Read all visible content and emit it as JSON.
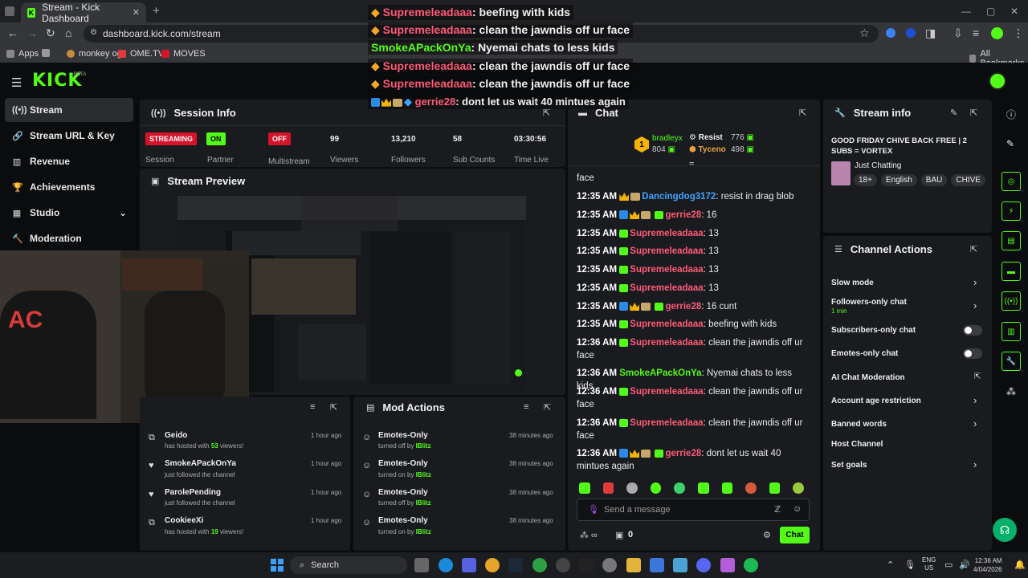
{
  "browser": {
    "tab_title": "Stream - Kick Dashboard",
    "url": "dashboard.kick.com/stream",
    "bookmarks": [
      "Apps",
      "monkey og",
      "OME.TV",
      "MOVES"
    ],
    "all_bookmarks": "All Bookmarks"
  },
  "brand": {
    "logo": "KICK",
    "beta": "BETA",
    "accent": "#53fc18"
  },
  "sidebar": {
    "items": [
      {
        "label": "Stream",
        "icon": "broadcast-icon"
      },
      {
        "label": "Stream URL & Key",
        "icon": "link-icon"
      },
      {
        "label": "Revenue",
        "icon": "chart-icon"
      },
      {
        "label": "Achievements",
        "icon": "trophy-icon"
      },
      {
        "label": "Studio",
        "icon": "grid-icon"
      },
      {
        "label": "Moderation",
        "icon": "gavel-icon"
      }
    ]
  },
  "session": {
    "title": "Session Info",
    "stats": [
      {
        "value": "STREAMING",
        "label": "Session"
      },
      {
        "value": "ON",
        "label": "Partner"
      },
      {
        "value": "OFF",
        "label": "Multistream"
      },
      {
        "value": "99",
        "label": "Viewers"
      },
      {
        "value": "13,210",
        "label": "Followers"
      },
      {
        "value": "58",
        "label": "Sub Counts"
      },
      {
        "value": "03:30:56",
        "label": "Time Live"
      }
    ]
  },
  "preview": {
    "title": "Stream Preview"
  },
  "hosts": [
    {
      "name": "Geido",
      "pre": "has hosted with ",
      "count": "53",
      "post": " viewers!",
      "time": "1 hour ago"
    },
    {
      "name": "SmokeAPackOnYa",
      "pre": "just followed the channel",
      "count": "",
      "post": "",
      "time": "1 hour ago"
    },
    {
      "name": "ParolePending",
      "pre": "just followed the channel",
      "count": "",
      "post": "",
      "time": "1 hour ago"
    },
    {
      "name": "CookieeXi",
      "pre": "has hosted with ",
      "count": "19",
      "post": " viewers!",
      "time": "1 hour ago"
    }
  ],
  "mod_actions": {
    "title": "Mod Actions",
    "items": [
      {
        "name": "Emotes-Only",
        "action": "turned off by ",
        "by": "IBlitz",
        "time": "38 minutes ago"
      },
      {
        "name": "Emotes-Only",
        "action": "turned on by ",
        "by": "IBlitz",
        "time": "38 minutes ago"
      },
      {
        "name": "Emotes-Only",
        "action": "turned off by ",
        "by": "IBlitz",
        "time": "38 minutes ago"
      },
      {
        "name": "Emotes-Only",
        "action": "turned on by ",
        "by": "IBlitz",
        "time": "38 minutes ago"
      }
    ]
  },
  "chat": {
    "title": "Chat",
    "top_user": {
      "rank": "1",
      "name": "bradleyx",
      "amount": "804"
    },
    "others": [
      {
        "name": "Resist",
        "amount": "776"
      },
      {
        "name": "Tyceno",
        "amount": "498"
      }
    ],
    "messages": [
      {
        "time": "",
        "user": "",
        "color": "#ffffff",
        "text": "face"
      },
      {
        "time": "12:35 AM",
        "user": "Dancingdog3172",
        "color": "#3fa3ff",
        "text": ": resist in drag blob"
      },
      {
        "time": "12:35 AM",
        "user": "gerrie28",
        "color": "#ff5a7a",
        "text": ": 16"
      },
      {
        "time": "12:35 AM",
        "user": "Supremeleadaaa",
        "color": "#ff5a7a",
        "text": ": 13"
      },
      {
        "time": "12:35 AM",
        "user": "Supremeleadaaa",
        "color": "#ff5a7a",
        "text": ": 13"
      },
      {
        "time": "12:35 AM",
        "user": "Supremeleadaaa",
        "color": "#ff5a7a",
        "text": ": 13"
      },
      {
        "time": "12:35 AM",
        "user": "Supremeleadaaa",
        "color": "#ff5a7a",
        "text": ": 13"
      },
      {
        "time": "12:35 AM",
        "user": "gerrie28",
        "color": "#ff5a7a",
        "text": ": 16 cunt"
      },
      {
        "time": "12:35 AM",
        "user": "Supremeleadaaa",
        "color": "#ff5a7a",
        "text": ": beefing with kids"
      },
      {
        "time": "12:36 AM",
        "user": "Supremeleadaaa",
        "color": "#ff5a7a",
        "text": ": clean the jawndis off ur face"
      },
      {
        "time": "12:36 AM",
        "user": "SmokeAPackOnYa",
        "color": "#53fc18",
        "text": ": Nyemai chats to less kids"
      },
      {
        "time": "12:36 AM",
        "user": "Supremeleadaaa",
        "color": "#ff5a7a",
        "text": ": clean the jawndis off ur face"
      },
      {
        "time": "12:36 AM",
        "user": "Supremeleadaaa",
        "color": "#ff5a7a",
        "text": ": clean the jawndis off ur face"
      },
      {
        "time": "12:36 AM",
        "user": "gerrie28",
        "color": "#ff5a7a",
        "text": ": dont let us wait 40 mintues again"
      }
    ],
    "placeholder": "Send a message",
    "viewers": "0",
    "send": "Chat"
  },
  "overlay": [
    {
      "user": "Supremeleadaaa",
      "text": ": beefing with kids"
    },
    {
      "user": "Supremeleadaaa",
      "text": ": clean the jawndis off ur face"
    },
    {
      "user": "SmokeAPackOnYa",
      "text": ": Nyemai chats to less kids"
    },
    {
      "user": "Supremeleadaaa",
      "text": ": clean the jawndis off ur face"
    },
    {
      "user": "Supremeleadaaa",
      "text": ": clean the jawndis off ur face"
    },
    {
      "user": "gerrie28",
      "text": ": dont let us wait 40 mintues again"
    }
  ],
  "stream_info": {
    "title": "Stream info",
    "stream_title": "GOOD FRIDAY CHIVE BACK FREE | 2 SUBS = VORTEX",
    "category": "Just Chatting",
    "tags": [
      "18+",
      "English",
      "BAU",
      "CHIVE"
    ]
  },
  "channel_actions": {
    "title": "Channel Actions",
    "items": [
      {
        "label": "Slow mode",
        "sub": "",
        "control": "chevron"
      },
      {
        "label": "Followers-only chat",
        "sub": "1 min",
        "control": "chevron"
      },
      {
        "label": "Subscribers-only chat",
        "sub": "",
        "control": "toggle"
      },
      {
        "label": "Emotes-only chat",
        "sub": "",
        "control": "toggle"
      },
      {
        "label": "AI Chat Moderation",
        "sub": "",
        "control": "external"
      },
      {
        "label": "Account age restriction",
        "sub": "",
        "control": "chevron"
      },
      {
        "label": "Banned words",
        "sub": "",
        "control": "chevron"
      },
      {
        "label": "Host Channel",
        "sub": "",
        "control": "none"
      },
      {
        "label": "Set goals",
        "sub": "",
        "control": "chevron"
      }
    ]
  },
  "taskbar": {
    "search": "Search",
    "lang1": "ENG",
    "lang2": "US",
    "time": "12:36 AM",
    "date": "4/04/2026"
  }
}
